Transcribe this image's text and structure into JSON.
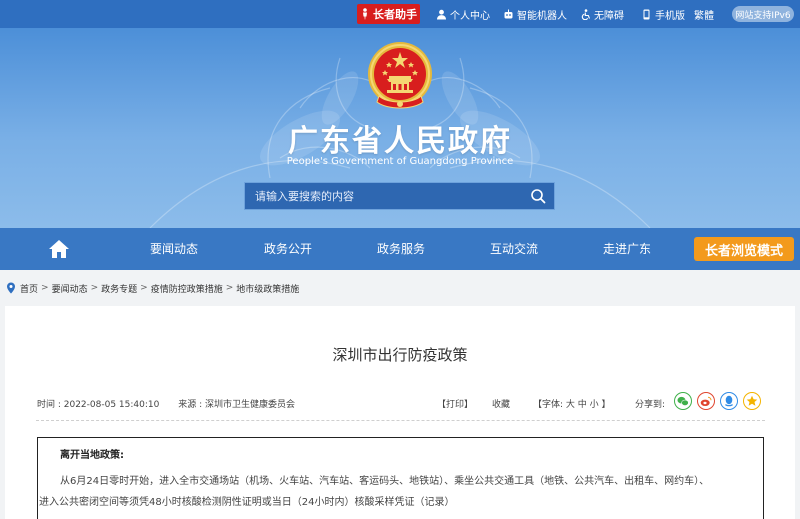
{
  "topbar": {
    "elder_helper": "长者助手",
    "personal_center": "个人中心",
    "robot": "智能机器人",
    "accessibility": "无障碍",
    "mobile": "手机版",
    "traditional": "繁體",
    "ipv6": "网站支持IPv6"
  },
  "banner": {
    "title": "广东省人民政府",
    "subtitle": "People's Government of Guangdong Province",
    "search_placeholder": "请输入要搜索的内容"
  },
  "nav": {
    "items": [
      "要闻动态",
      "政务公开",
      "政务服务",
      "互动交流",
      "走进广东"
    ],
    "elder_mode": "长者浏览模式"
  },
  "breadcrumb": [
    "首页",
    "要闻动态",
    "政务专题",
    "疫情防控政策措施",
    "地市级政策措施"
  ],
  "article": {
    "title": "深圳市出行防疫政策",
    "time": "时间 : 2022-08-05 15:40:10",
    "source": "来源 : 深圳市卫生健康委员会",
    "print": "【打印】",
    "favorite": "收藏",
    "font_size": "【字体: 大  中  小 】",
    "share_label": "分享到:",
    "notice_heading": "离开当地政策:",
    "para1": "从6月24日零时开始，进入全市交通场站（机场、火车站、汽车站、客运码头、地铁站）、乘坐公共交通工具（地铁、公共汽车、出租车、网约车）、",
    "para2": "进入公共密闭空间等须凭48小时核酸检测阴性证明或当日（24小时内）核酸采样凭证（记录）"
  },
  "colors": {
    "topbar": "#2f6fc0",
    "nav": "#3978c4",
    "elder_red": "#d81e1e",
    "elder_orange": "#f39a1c",
    "wechat": "#3fb04a",
    "weibo": "#e0452f",
    "qq": "#2f8be6",
    "qzone": "#f4b400"
  },
  "icons": {
    "elder": "elder-person-icon",
    "user": "user-icon",
    "robot": "robot-icon",
    "accessibility": "accessibility-icon",
    "mobile": "mobile-phone-icon",
    "search": "search-icon",
    "home": "home-icon",
    "location": "location-pin-icon",
    "wechat": "wechat-icon",
    "weibo": "weibo-icon",
    "qq": "qq-icon",
    "qzone": "qzone-icon"
  }
}
